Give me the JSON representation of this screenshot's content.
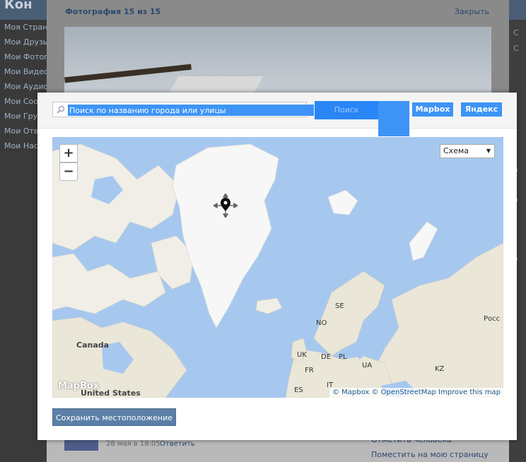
{
  "vk": {
    "logo": "Кон",
    "left_menu": [
      "Моя Страни",
      "Мои Друзья",
      "Мои Фотогр",
      "Мои Видеоз",
      "Мои Аудиоз",
      "Мои Сообщ",
      "Мои Групп",
      "Мои Ответ",
      "Мои Настр"
    ],
    "right_fragments": [
      "С",
      "С",
      "о",
      "о",
      "о"
    ],
    "photo_title": "Фотография 15 из 15",
    "close_label": "Закрыть",
    "comment_date": "28 мая в 18:05",
    "comment_reply": "Ответить",
    "right_link_1": "Отметить человека",
    "right_link_2": "Поместить на мою страницу"
  },
  "dialog": {
    "search_placeholder": "Поиск по названию города или улицы",
    "search_button": "Поиск",
    "providers": [
      "Mapbox",
      "Яндекс"
    ],
    "map_type": "Схема",
    "zoom_in": "+",
    "zoom_out": "−",
    "mapbox_logo": "MapBox",
    "attribution": "© Mapbox © OpenStreetMap Improve this map",
    "save_button": "Сохранить местоположение"
  },
  "map_labels": [
    "SE",
    "NO",
    "UK",
    "DE",
    "PL",
    "FR",
    "UA",
    "ES",
    "IT",
    "KZ",
    "Canada",
    "United States",
    "Росс"
  ],
  "colors": {
    "water": "#a6c8ef",
    "land": "#f0eee6",
    "ice": "#f7f7f7",
    "accent_blue": "#3d94f6",
    "save_button": "#5b7fa6"
  }
}
